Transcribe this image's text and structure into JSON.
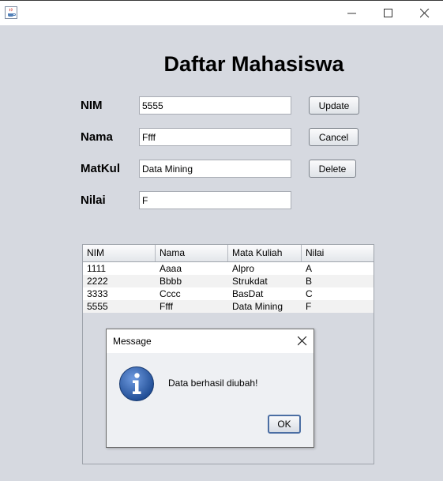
{
  "window": {
    "app_icon": "java-cup-icon",
    "controls": [
      "minimize-icon",
      "maximize-icon",
      "close-icon"
    ]
  },
  "form": {
    "title": "Daftar Mahasiswa",
    "fields": [
      {
        "label": "NIM",
        "value": "5555"
      },
      {
        "label": "Nama",
        "value": "Ffff"
      },
      {
        "label": "MatKul",
        "value": "Data Mining"
      },
      {
        "label": "Nilai",
        "value": "F"
      }
    ],
    "buttons": {
      "update": "Update",
      "cancel": "Cancel",
      "delete": "Delete"
    }
  },
  "table": {
    "columns": [
      "NIM",
      "Nama",
      "Mata Kuliah",
      "Nilai"
    ],
    "rows": [
      [
        "1111",
        "Aaaa",
        "Alpro",
        "A"
      ],
      [
        "2222",
        "Bbbb",
        "Strukdat",
        "B"
      ],
      [
        "3333",
        "Cccc",
        "BasDat",
        "C"
      ],
      [
        "5555",
        "Ffff",
        "Data Mining",
        "F"
      ]
    ]
  },
  "dialog": {
    "title": "Message",
    "message": "Data berhasil diubah!",
    "ok_label": "OK",
    "icon": "info-icon"
  },
  "colors": {
    "background": "#d6d9e0",
    "accent": "#4b6ea3",
    "info_icon": "#2f5fa8"
  }
}
